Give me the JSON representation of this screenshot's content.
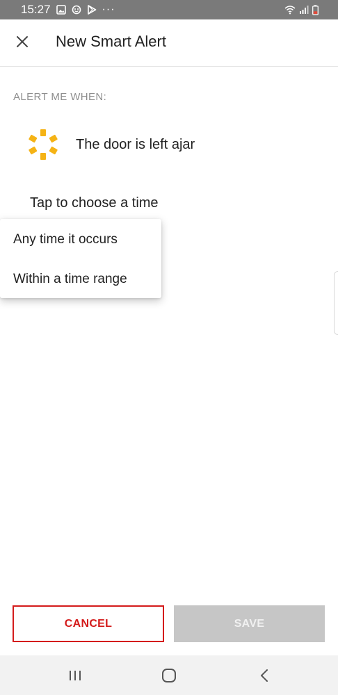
{
  "status_bar": {
    "time": "15:27",
    "icons": [
      "image-icon",
      "face-icon",
      "play-store-icon",
      "more-dots-icon",
      "wifi-icon",
      "signal-icon",
      "battery-icon"
    ],
    "more": "···"
  },
  "header": {
    "close_icon": "close-icon",
    "title": "New Smart Alert"
  },
  "section": {
    "label": "ALERT ME WHEN:"
  },
  "condition": {
    "icon": "door-ajar-icon",
    "text": "The door is left ajar"
  },
  "time_chooser": {
    "label": "Tap to choose a time"
  },
  "menu": {
    "items": [
      {
        "label": "Any time it occurs"
      },
      {
        "label": "Within a time range"
      }
    ]
  },
  "actions": {
    "cancel_label": "CANCEL",
    "save_label": "SAVE"
  },
  "nav_bar": {
    "icons": [
      "recent-apps-icon",
      "home-icon",
      "back-icon"
    ]
  },
  "colors": {
    "accent_red": "#d41b1b",
    "status_bar_bg": "#7a7a7a",
    "icon_yellow": "#f5b315",
    "disabled_button": "#c6c6c6"
  }
}
